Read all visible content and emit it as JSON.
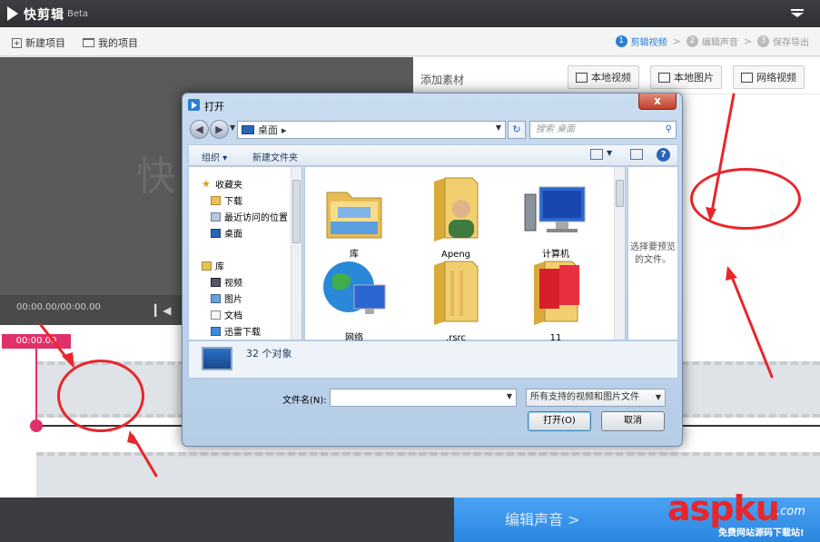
{
  "titlebar": {
    "app_name": "快剪辑",
    "beta": "Beta"
  },
  "toolbar": {
    "new_project": "新建项目",
    "my_projects": "我的项目",
    "steps": [
      {
        "num": "1",
        "label": "剪辑视频"
      },
      {
        "num": "2",
        "label": "编辑声音"
      },
      {
        "num": "3",
        "label": "保存导出"
      }
    ],
    "step_sep": ">"
  },
  "preview": {
    "watermark": "快",
    "timecode": "00:00.00/00:00.00"
  },
  "material": {
    "title": "添加素材",
    "buttons": {
      "local_video": "本地视频",
      "local_image": "本地图片",
      "web_video": "网络视频"
    }
  },
  "timeline": {
    "cursor_time": "00:00.00"
  },
  "bottom": {
    "next_label": "编辑声音 >"
  },
  "site": {
    "brand_a": "asp",
    "brand_b": "ku",
    "tld": ".com",
    "tagline": "免费网站源码下载站!"
  },
  "dialog": {
    "title": "打开",
    "close": "x",
    "address": "桌面",
    "address_arrow": "▸",
    "search_placeholder": "搜索 桌面",
    "commands": {
      "organize": "组织 ▾",
      "new_folder": "新建文件夹"
    },
    "nav_items": [
      {
        "label": "收藏夹",
        "icon": "star-icon"
      },
      {
        "label": "下载",
        "icon": "download-folder-icon"
      },
      {
        "label": "最近访问的位置",
        "icon": "recent-places-icon"
      },
      {
        "label": "桌面",
        "icon": "desktop-icon"
      },
      {
        "label": "库",
        "icon": "library-icon"
      },
      {
        "label": "视频",
        "icon": "video-library-icon"
      },
      {
        "label": "图片",
        "icon": "picture-library-icon"
      },
      {
        "label": "文档",
        "icon": "document-library-icon"
      },
      {
        "label": "迅雷下载",
        "icon": "thunder-download-icon"
      }
    ],
    "files": [
      {
        "label": "库",
        "icon": "library-folder-icon"
      },
      {
        "label": "Apeng",
        "icon": "user-folder-icon"
      },
      {
        "label": "计算机",
        "icon": "computer-icon"
      },
      {
        "label": "网络",
        "icon": "network-icon"
      },
      {
        "label": ".rsrc",
        "icon": "folder-icon"
      },
      {
        "label": "11",
        "icon": "image-folder-icon"
      }
    ],
    "preview_hint": "选择要预览的文件。",
    "object_count": "32 个对象",
    "filename_label": "文件名(N):",
    "filename_value": "",
    "filter": "所有支持的视频和图片文件",
    "open_button": "打开(O)",
    "cancel_button": "取消"
  }
}
